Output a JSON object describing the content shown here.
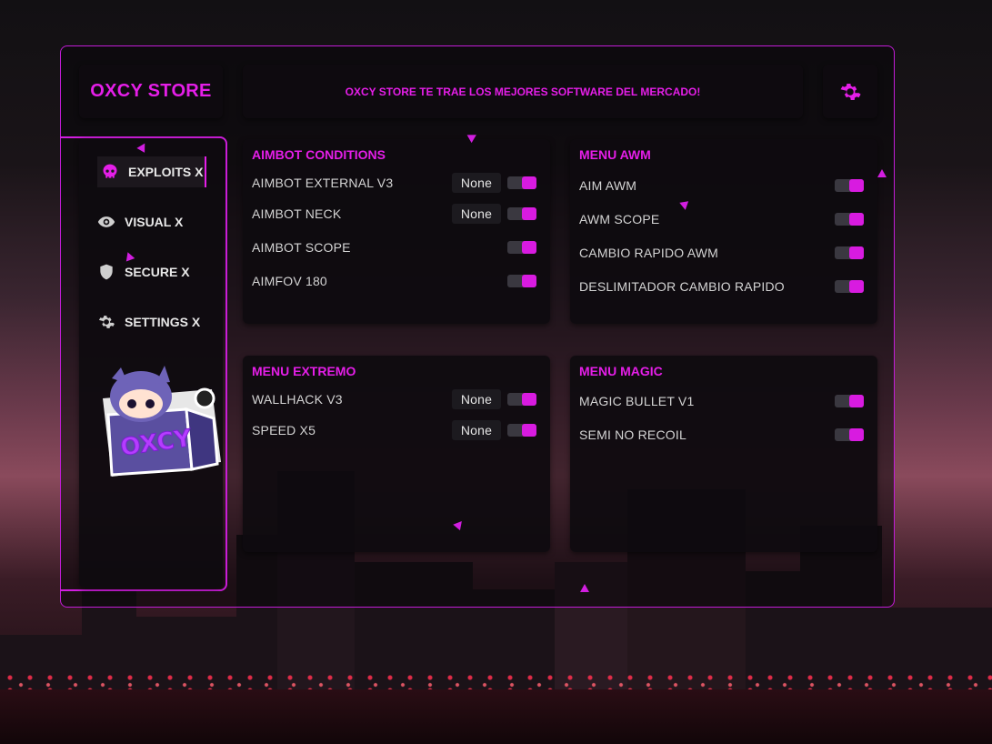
{
  "brand": {
    "title": "OXCY STORE"
  },
  "banner": {
    "text": "OXCY STORE TE TRAE LOS MEJORES SOFTWARE DEL MERCADO!"
  },
  "colors": {
    "accent": "#e51ee8",
    "panel": "#0e0b0f",
    "toggle_off": "#3a3840"
  },
  "sidebar": {
    "items": [
      {
        "label": "EXPLOITS X",
        "icon": "skull-icon",
        "active": true
      },
      {
        "label": "VISUAL X",
        "icon": "eye-icon",
        "active": false
      },
      {
        "label": "SECURE X",
        "icon": "shield-icon",
        "active": false
      },
      {
        "label": "SETTINGS X",
        "icon": "gear-icon",
        "active": false
      }
    ],
    "mascot_text": "OXCY"
  },
  "cards": {
    "aimbot": {
      "title": "AIMBOT CONDITIONS",
      "rows": [
        {
          "label": "AIMBOT EXTERNAL V3",
          "select": "None",
          "toggle": true
        },
        {
          "label": "AIMBOT NECK",
          "select": "None",
          "toggle": true
        },
        {
          "label": "AIMBOT SCOPE",
          "toggle": true
        },
        {
          "label": "AIMFOV 180",
          "toggle": true
        }
      ]
    },
    "awm": {
      "title": "MENU AWM",
      "rows": [
        {
          "label": "AIM AWM",
          "toggle": true
        },
        {
          "label": "AWM SCOPE",
          "toggle": true
        },
        {
          "label": "CAMBIO RAPIDO AWM",
          "toggle": true
        },
        {
          "label": "DESLIMITADOR CAMBIO RAPIDO",
          "toggle": true
        }
      ]
    },
    "extremo": {
      "title": "MENU EXTREMO",
      "rows": [
        {
          "label": "WALLHACK V3",
          "select": "None",
          "toggle": true
        },
        {
          "label": "SPEED X5",
          "select": "None",
          "toggle": true
        }
      ]
    },
    "magic": {
      "title": "MENU MAGIC",
      "rows": [
        {
          "label": "MAGIC BULLET V1",
          "toggle": true
        },
        {
          "label": "SEMI NO RECOIL",
          "toggle": true
        }
      ]
    }
  }
}
